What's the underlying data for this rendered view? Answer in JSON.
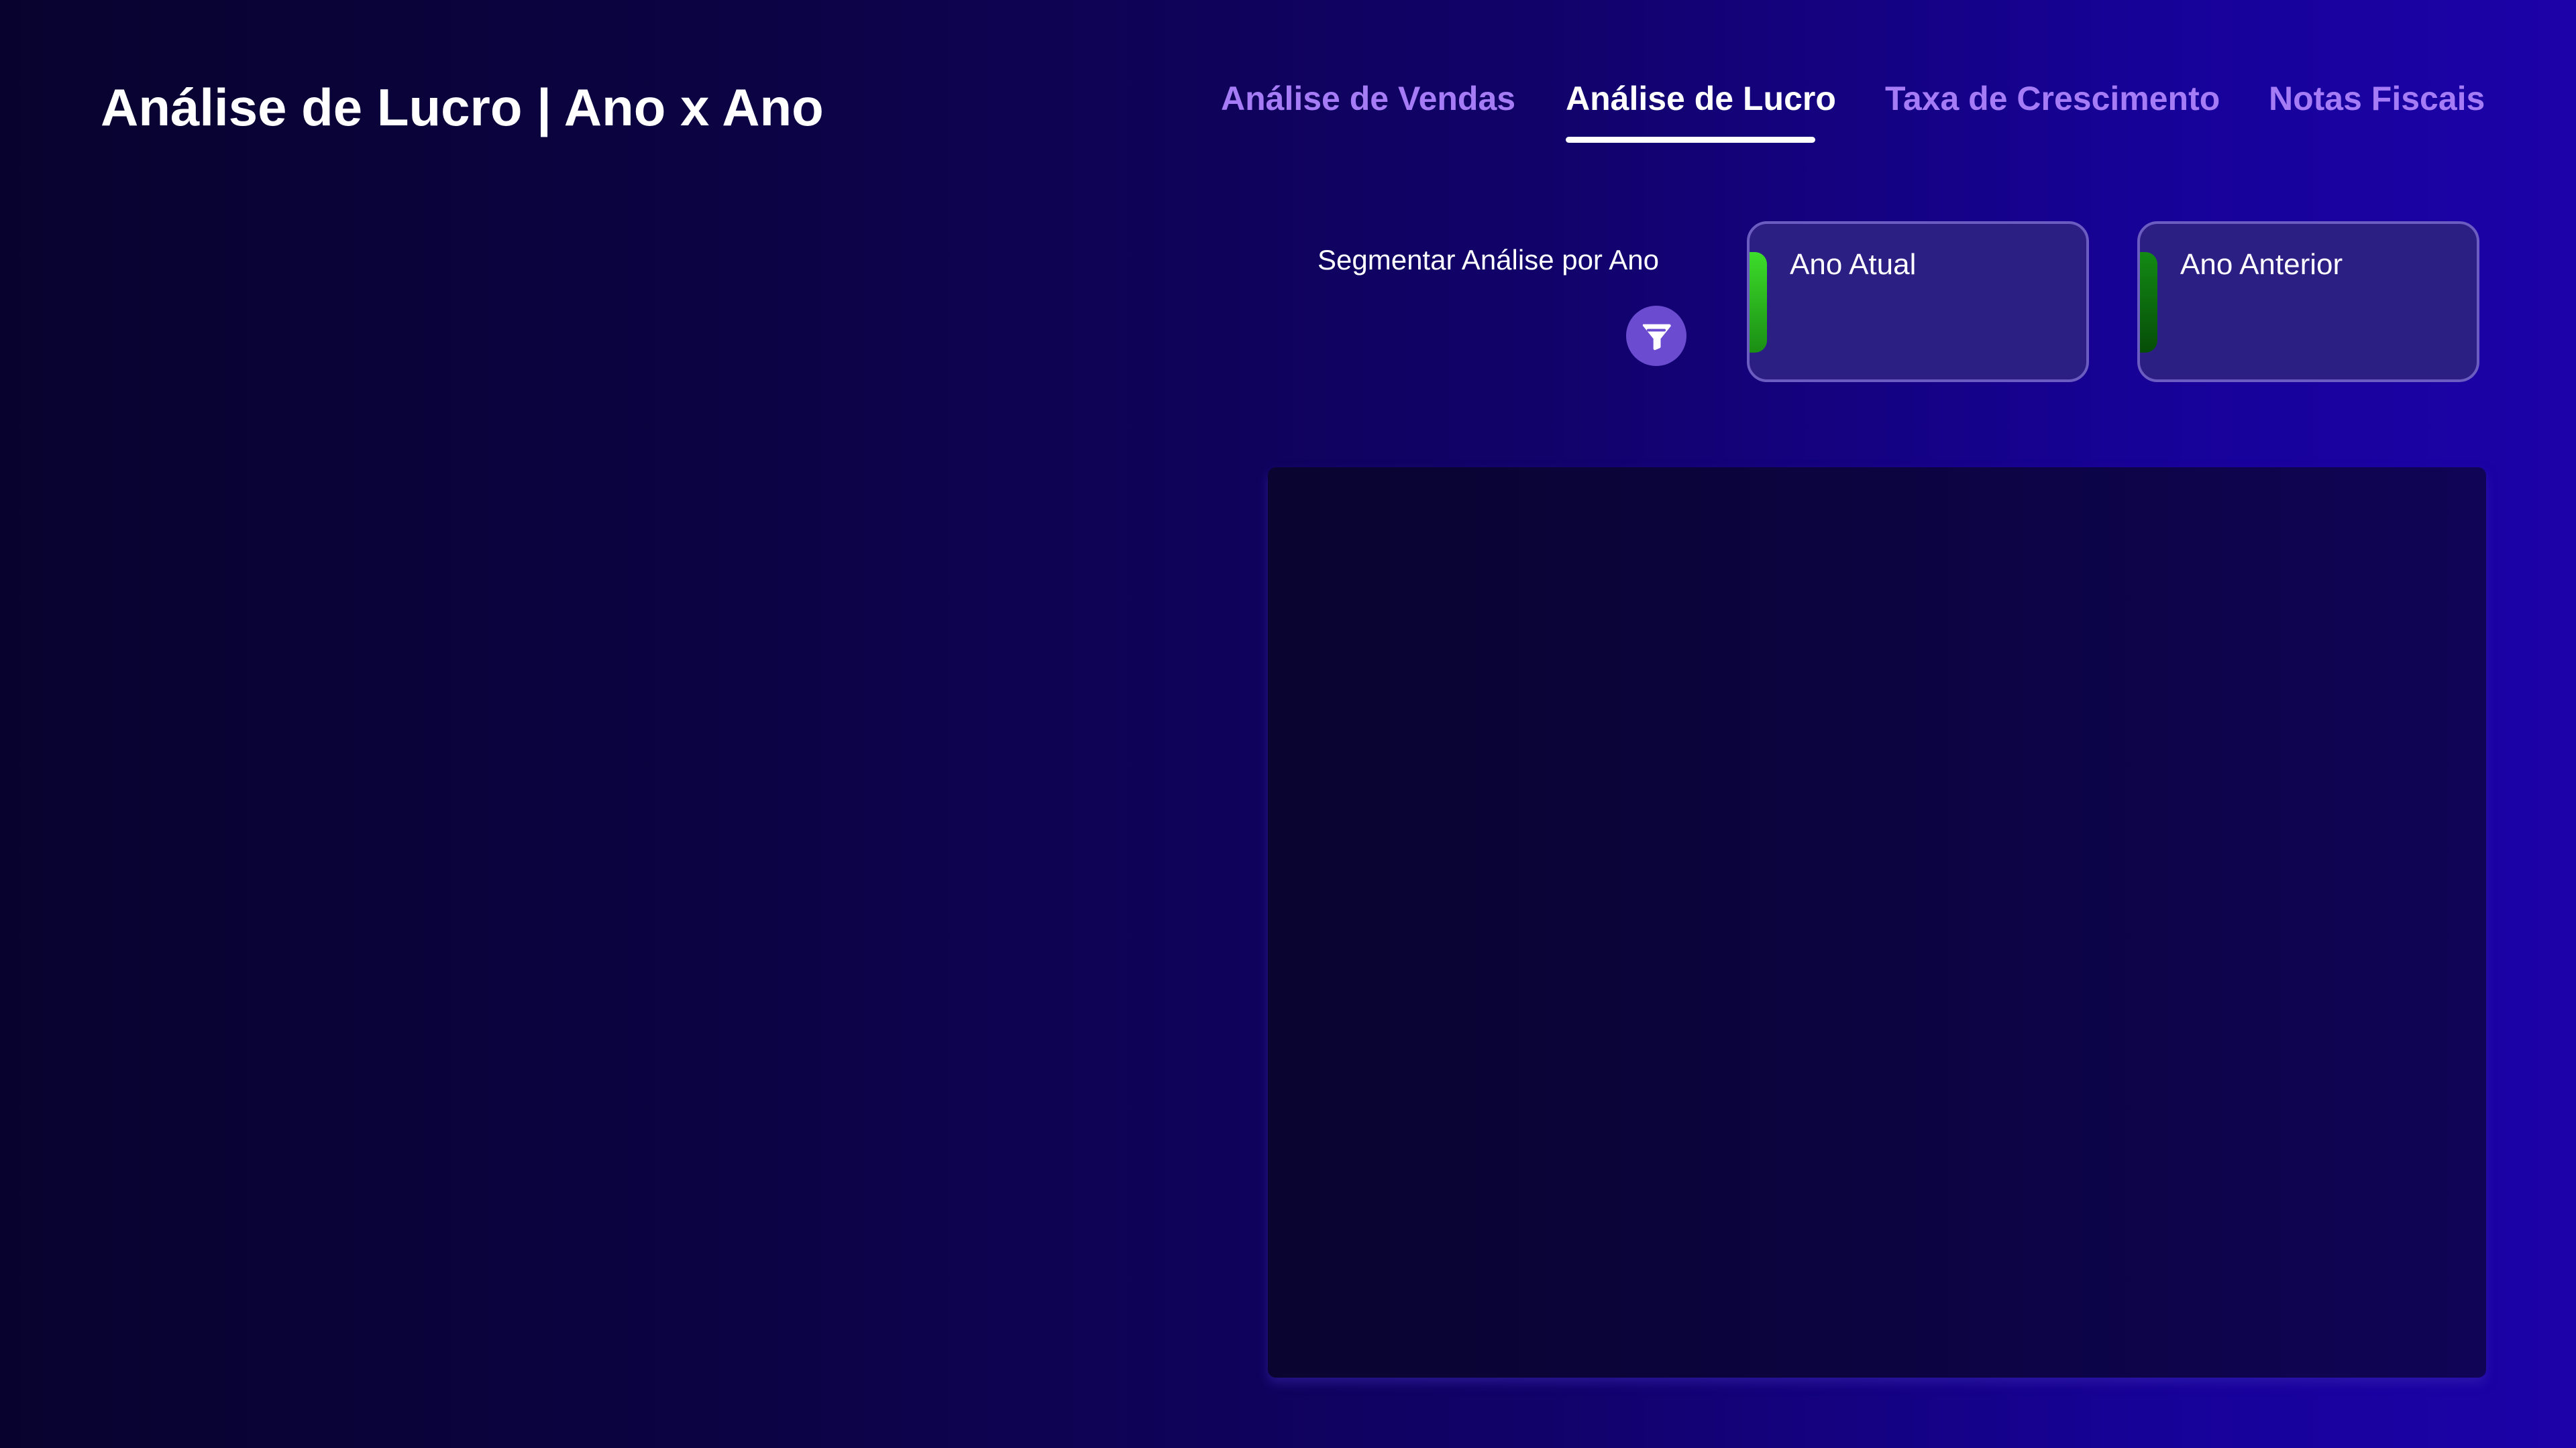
{
  "header": {
    "title": "Análise de Lucro | Ano x Ano"
  },
  "nav": {
    "tabs": [
      {
        "label": "Análise de Vendas",
        "active": false
      },
      {
        "label": "Análise de Lucro",
        "active": true
      },
      {
        "label": "Taxa de Crescimento",
        "active": false
      },
      {
        "label": "Notas Fiscais",
        "active": false
      }
    ]
  },
  "filter": {
    "label": "Segmentar Análise por Ano",
    "icon": "filter-icon",
    "options": [
      {
        "label": "Ano Atual",
        "accent_color": "#3ddc2a"
      },
      {
        "label": "Ano Anterior",
        "accent_color": "#138a14"
      }
    ]
  },
  "colors": {
    "background_start": "#08032e",
    "background_end": "#1c02a8",
    "nav_inactive": "#a57cf5",
    "nav_active": "#ffffff",
    "card_background": "#2c1f84",
    "filter_icon_bg": "#6b4bd0"
  }
}
